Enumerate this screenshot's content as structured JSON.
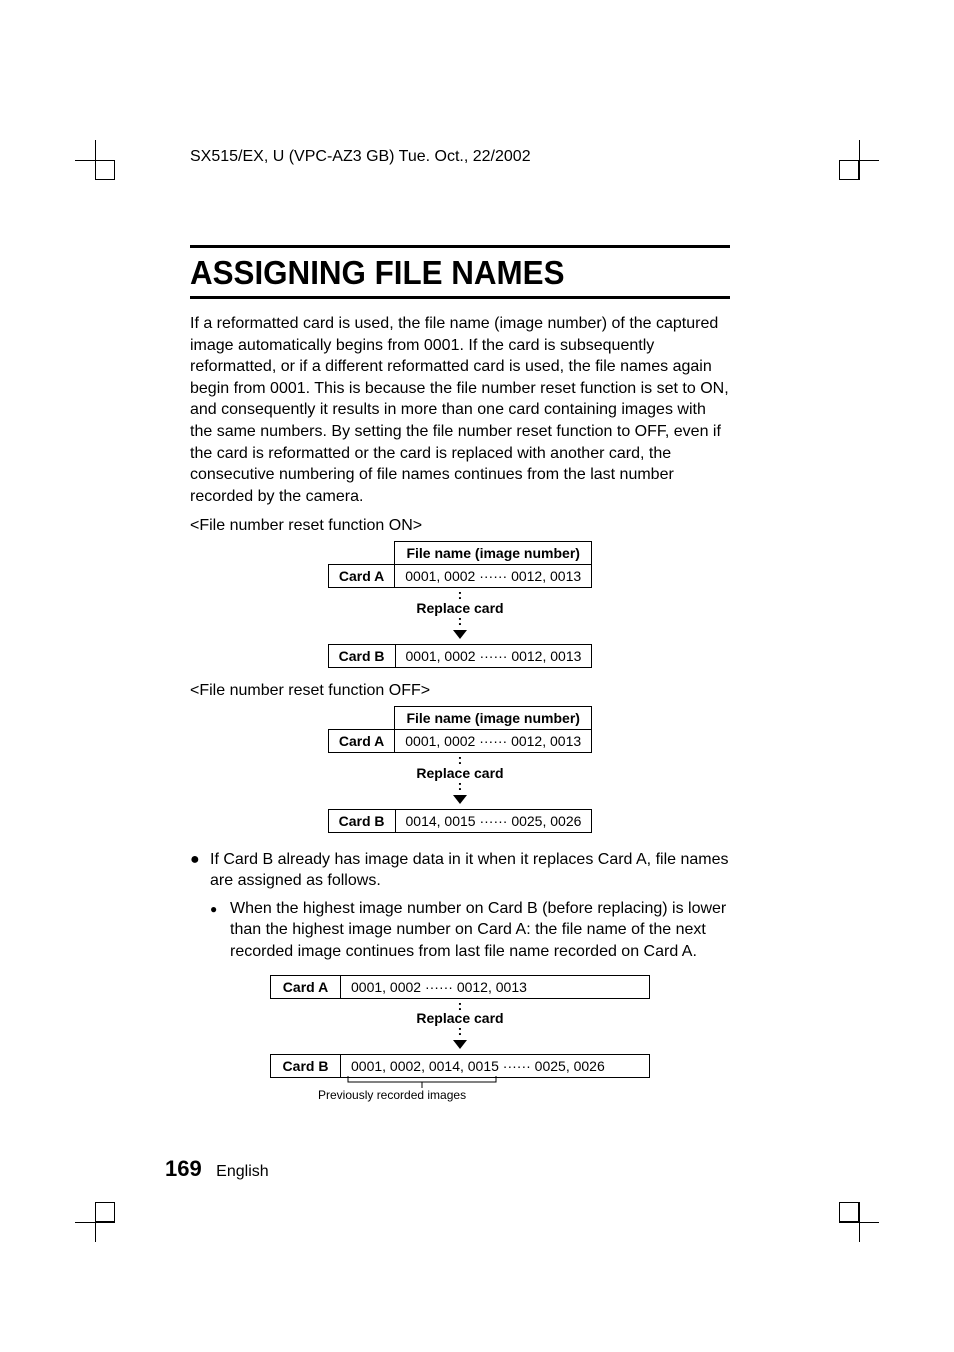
{
  "header": "SX515/EX, U (VPC-AZ3 GB)    Tue. Oct., 22/2002",
  "title": "ASSIGNING FILE NAMES",
  "intro": "If a reformatted card is used, the file name (image number) of the captured image automatically begins from 0001. If the card is subsequently reformatted, or if a different reformatted card is used, the file names again begin from 0001. This is because the file number reset function is set to ON, and consequently it results in more than one card containing images with the same numbers. By setting the file number reset function to OFF, even if the card is reformatted or the card is replaced with another card, the consecutive numbering of file names continues from the last number recorded by the camera.",
  "example1": {
    "label": "<File number reset function ON>",
    "colHeader": "File name (image number)",
    "cardA": "Card A",
    "cardAVal": "0001, 0002 ······ 0012, 0013",
    "replace": "Replace card",
    "cardB": "Card B",
    "cardBVal": "0001, 0002 ······ 0012, 0013"
  },
  "example2": {
    "label": "<File number reset function OFF>",
    "colHeader": "File name (image number)",
    "cardA": "Card A",
    "cardAVal": "0001, 0002 ······ 0012, 0013",
    "replace": "Replace card",
    "cardB": "Card B",
    "cardBVal": "0014, 0015 ······ 0025, 0026"
  },
  "bullet1": "If Card B already has image data in it when it replaces Card A, file names are assigned as follows.",
  "bullet2": "When the highest image number on Card B (before replacing) is lower than the highest image number on Card A: the file name of the next recorded image continues from last file name recorded on Card A.",
  "example3": {
    "cardA": "Card A",
    "cardAVal": "0001, 0002 ······ 0012, 0013",
    "replace": "Replace card",
    "cardB": "Card B",
    "cardBVal": "0001, 0002, 0014, 0015 ······ 0025, 0026",
    "prevLabel": "Previously recorded images"
  },
  "footer": {
    "page": "169",
    "lang": "English"
  }
}
